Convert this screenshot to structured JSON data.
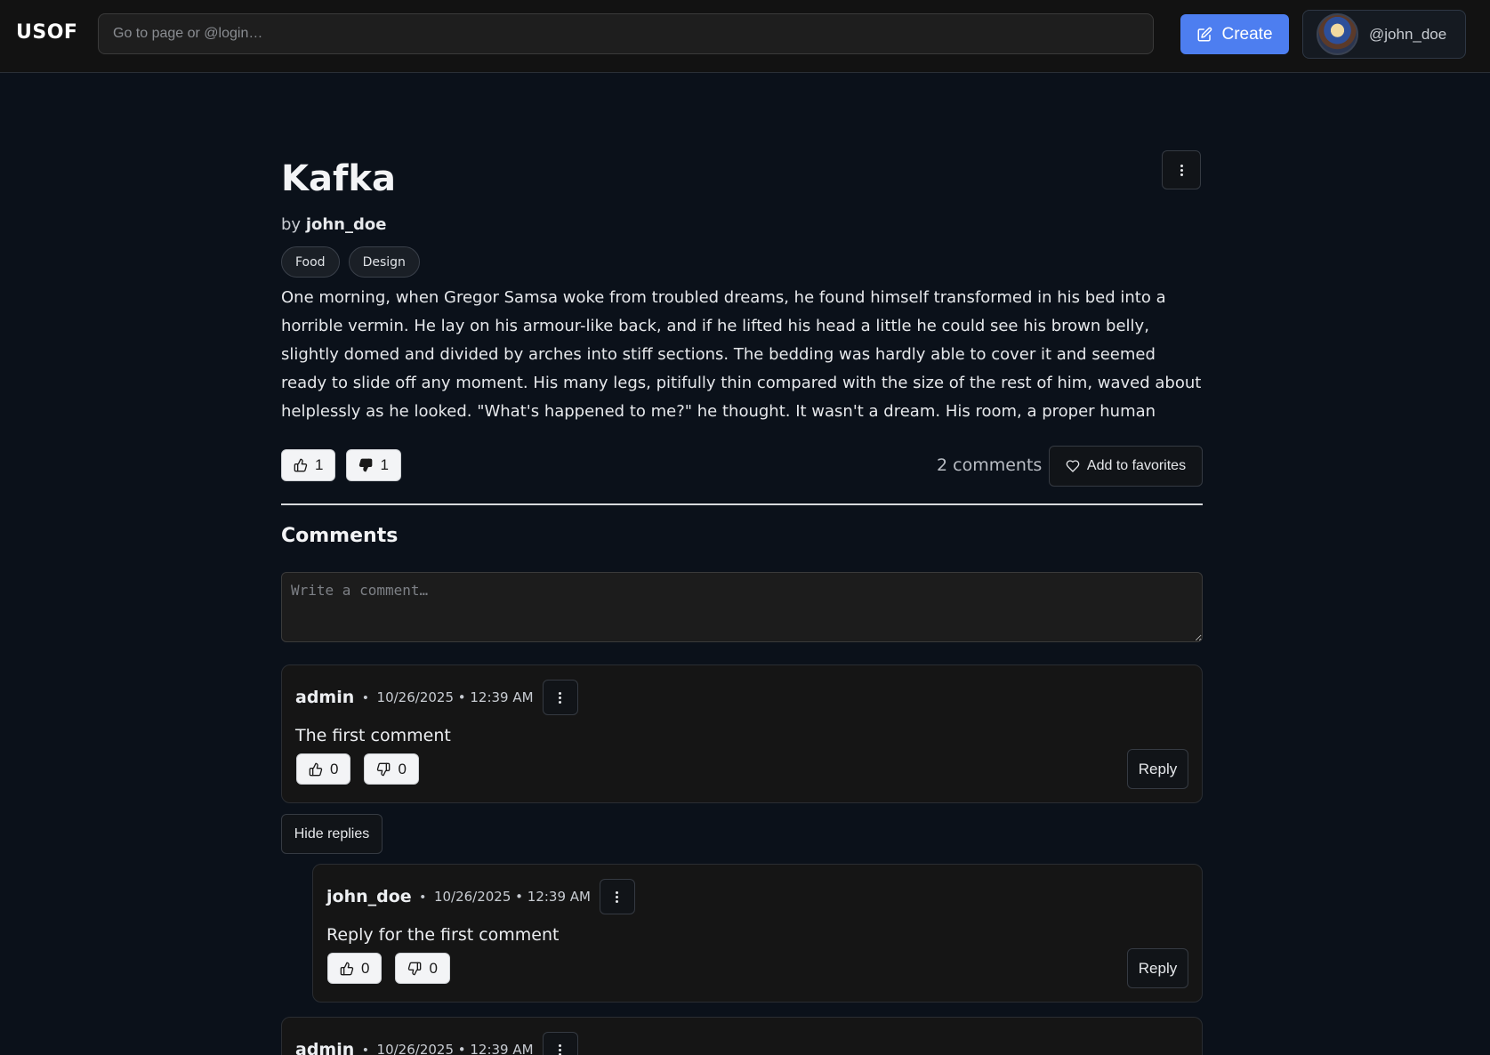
{
  "header": {
    "logo": "USOF",
    "search_placeholder": "Go to page or @login…",
    "create_label": "Create",
    "user_handle": "@john_doe"
  },
  "post": {
    "title": "Kafka",
    "by_prefix": "by",
    "author": "john_doe",
    "tags": [
      "Food",
      "Design"
    ],
    "body": "One morning, when Gregor Samsa woke from troubled dreams, he found himself transformed in his bed into a horrible vermin. He lay on his armour-like back, and if he lifted his head a little he could see his brown belly, slightly domed and divided by arches into stiff sections. The bedding was hardly able to cover it and seemed ready to slide off any moment. His many legs, pitifully thin compared with the size of the rest of him, waved about helplessly as he looked. \"What's happened to me?\" he thought. It wasn't a dream. His room, a proper human",
    "likes": "1",
    "dislikes": "1",
    "comment_count": "2 comments",
    "favorite_label": "Add to favorites"
  },
  "comments_section": {
    "heading": "Comments",
    "input_placeholder": "Write a comment…",
    "hide_replies_label": "Hide replies",
    "reply_label": "Reply",
    "separator": "•",
    "items": [
      {
        "author": "admin",
        "time": "10/26/2025 • 12:39 AM",
        "text": "The first comment",
        "likes": "0",
        "dislikes": "0"
      },
      {
        "author": "john_doe",
        "time": "10/26/2025 • 12:39 AM",
        "text": "Reply for the first comment",
        "likes": "0",
        "dislikes": "0"
      },
      {
        "author": "admin",
        "time": "10/26/2025 • 12:39 AM"
      }
    ]
  },
  "colors": {
    "background": "#0b111a",
    "accent": "#4d7ef0",
    "card": "#151515"
  },
  "icons": [
    "edit-icon",
    "kebab-menu-icon",
    "thumbs-up-icon",
    "thumbs-down-icon",
    "heart-icon"
  ]
}
